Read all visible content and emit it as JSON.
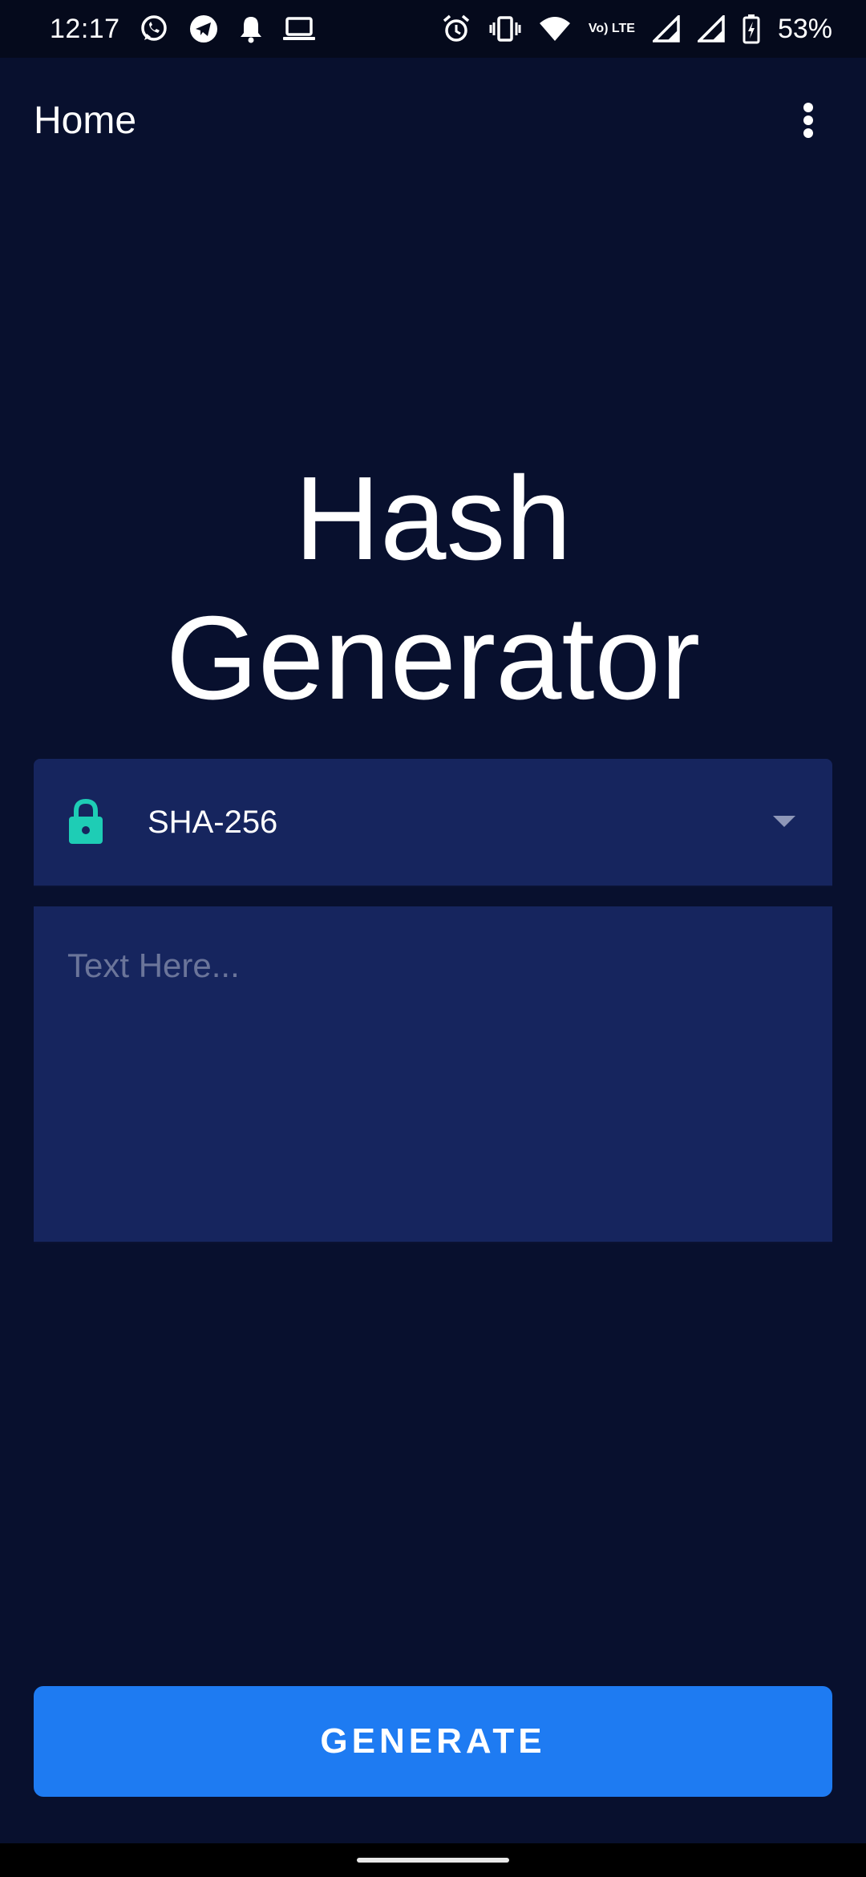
{
  "status_bar": {
    "time": "12:17",
    "battery": "53%",
    "network_label": "Vo) LTE",
    "icons_left": [
      "whatsapp-icon",
      "telegram-icon",
      "notification-bell-icon",
      "laptop-icon"
    ],
    "icons_right": [
      "alarm-icon",
      "vibrate-icon",
      "wifi-icon",
      "signal-icon",
      "battery-icon"
    ]
  },
  "app_bar": {
    "title": "Home",
    "menu_icon": "more-vert-icon"
  },
  "hero": {
    "line1": "Hash",
    "line2": "Generator"
  },
  "algorithm": {
    "icon": "lock-icon",
    "selected": "SHA-256"
  },
  "input": {
    "placeholder": "Text Here...",
    "value": ""
  },
  "generate": {
    "label": "GENERATE"
  },
  "colors": {
    "background": "#08102E",
    "field": "#16255E",
    "accent": "#1E7BF2",
    "lock": "#1ECDB5"
  }
}
